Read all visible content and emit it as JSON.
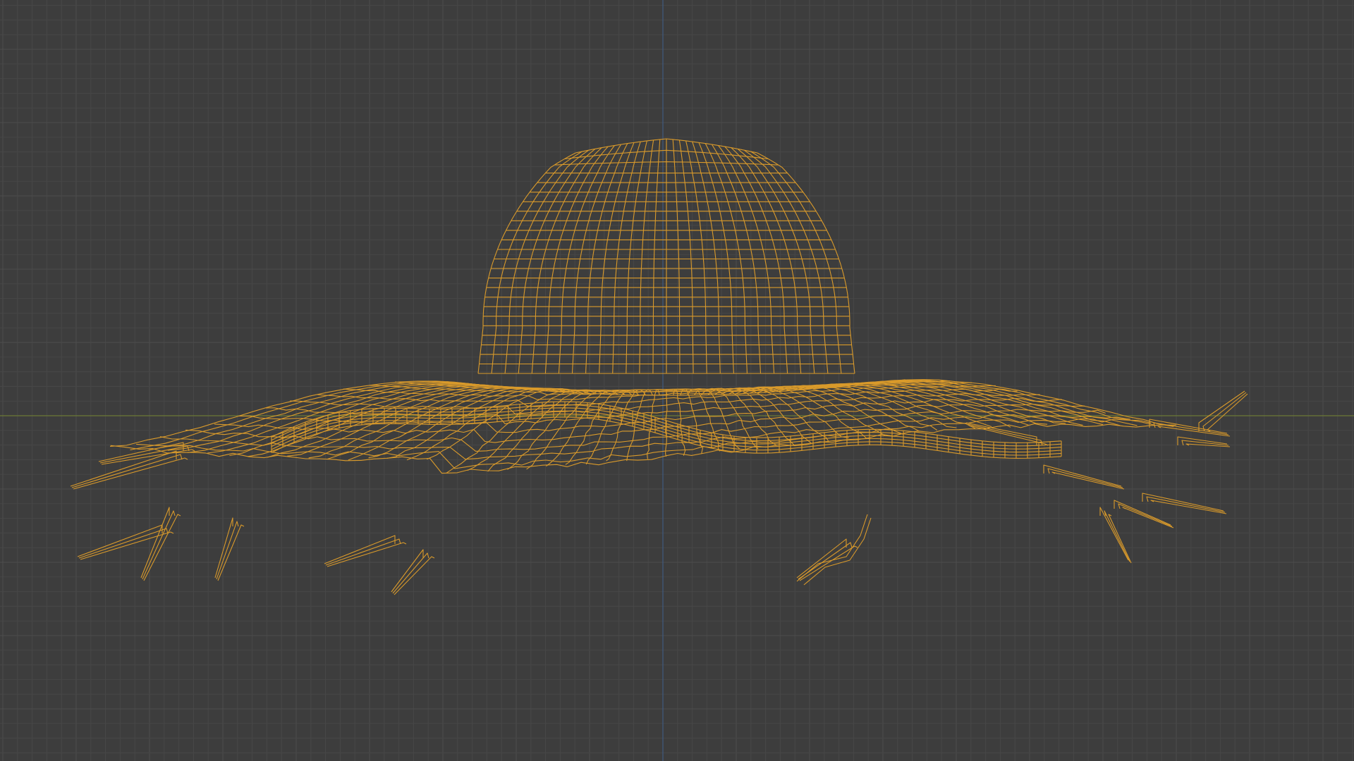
{
  "viewport": {
    "mode": "wireframe",
    "object": "hat-mesh",
    "colors": {
      "background": "#3d3d3d",
      "grid_minor": "#474747",
      "grid_major": "#4d4d4d",
      "axis_x": "#6b7a35",
      "axis_y": "#3f5a80",
      "wire": "#d99a2b"
    }
  }
}
